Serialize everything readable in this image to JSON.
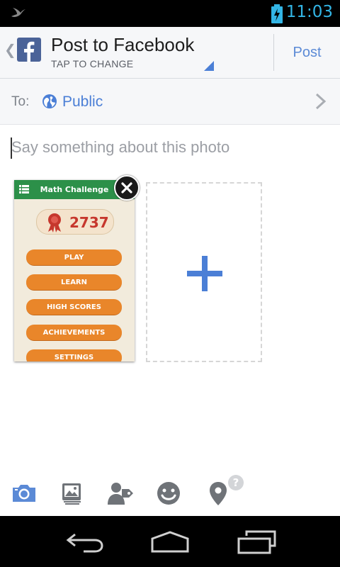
{
  "status_bar": {
    "time": "11:03"
  },
  "header": {
    "title": "Post to Facebook",
    "subtitle": "TAP TO CHANGE",
    "post_label": "Post"
  },
  "audience": {
    "to_label": "To:",
    "value": "Public"
  },
  "composer": {
    "placeholder": "Say something about this photo"
  },
  "attachment": {
    "app_title": "Math Challenge",
    "score": "2737",
    "menu_buttons": [
      "PLAY",
      "LEARN",
      "HIGH SCORES",
      "ACHIEVEMENTS",
      "SETTINGS"
    ]
  },
  "toolbar": {
    "icons": [
      "camera-icon",
      "photo-album-icon",
      "tag-people-icon",
      "emoticon-icon",
      "location-icon"
    ],
    "location_badge": "?"
  },
  "colors": {
    "accent_blue": "#4b7fd6",
    "facebook_blue": "#4b6398",
    "status_blue": "#33b5e5",
    "thumb_green": "#2c9049",
    "thumb_orange": "#e9862a",
    "score_red": "#c6372d"
  }
}
